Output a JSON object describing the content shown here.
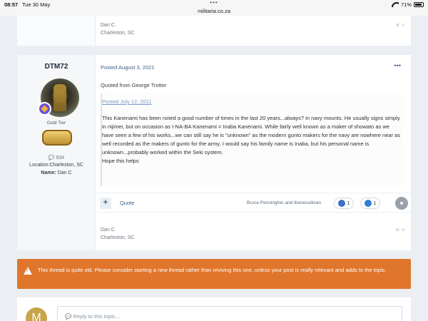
{
  "status_bar": {
    "time": "08:57",
    "date": "Tue 30 May",
    "url": "militaria.co.za",
    "battery": "71%",
    "dots": "•••"
  },
  "prev_post": {
    "signature_line1": "Dan C.",
    "signature_line2": "Charleston, SC"
  },
  "post": {
    "author": "DTM72",
    "tier": "Gold Tier",
    "post_count": "934",
    "location_label": "Location:",
    "location": "Charleston, SC",
    "name_label": "Name:",
    "name": "Dan C",
    "date": "Posted August 3, 2021",
    "more_icon": "•••",
    "quoted_from": "Quoted from George Trotter",
    "quote_date": "Posted July 12, 2011",
    "quote_paragraphs": [
      "This Kanenami has been noted a good number of times in the last 20 years...always? in navy mounts. He usually signs simply in nijimei, but on occasion as I-NA-BA Kanenami = Inaba Kanenami. While fairly well known as a maker of showato as we have seen a few of his works...we can still say he is \"unknown\" as the modern gunto makers for the navy are nowhere near as well recorded as the makers of gunto for the army. I would say his family name is Inaba, but his personal name is unknown...probably worked within the Seki system.",
      "Hope this helps"
    ],
    "actions": {
      "plus": "+",
      "quote": "Quote",
      "reactors": "Bruce Pennington and tbonesullivan",
      "reaction1_count": "1",
      "reaction2_count": "1"
    },
    "signature_line1": "Dan C.",
    "signature_line2": "Charleston, SC"
  },
  "warning": {
    "text": "This thread is quite old. Please consider starting a new thread rather than reviving this one, unless your post is really relevant and adds to the topic."
  },
  "reply": {
    "avatar_letter": "M",
    "placeholder": "Reply to this topic..."
  },
  "colors": {
    "accent": "#3b5f86",
    "warning": "#e0762b",
    "background": "#ebeef2"
  }
}
